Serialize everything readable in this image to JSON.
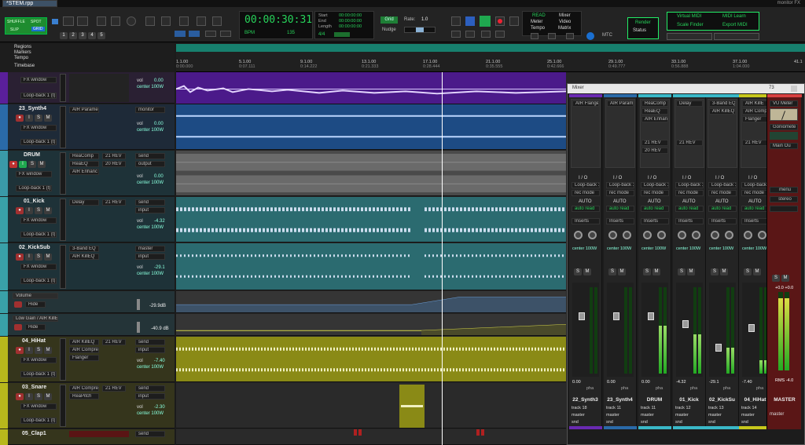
{
  "window": {
    "tab_title": "*STEM.rpp",
    "right_label": "monitor FX"
  },
  "toolbar": {
    "mode_buttons": [
      "SHUFFLE",
      "SPOT",
      "SLIP",
      "GRID"
    ],
    "zoom_numbers": [
      "1",
      "2",
      "3",
      "4",
      "5"
    ],
    "time": "00:00:30:31",
    "bpm_label": "BPM",
    "bpm": "135",
    "timesig": "4/4",
    "start_label": "Start",
    "end_label": "End",
    "length_label": "Length",
    "start": "00:00:00:00",
    "end": "00:00:00:00",
    "length": "00:00:00:00",
    "grid_label": "Grid",
    "rate_label": "Rate:",
    "rate": "1.0",
    "nudge_label": "Nudge",
    "read": "READ",
    "meter": "Meter",
    "tempo": "Tempo",
    "mixer": "Mixer",
    "video": "Video",
    "matrix": "Matrix",
    "mtc": "MTC",
    "render": "Render",
    "status": "Status",
    "virtual_midi": "Virtual MIDI",
    "midi_learn": "MIDI Learn",
    "scale_finder": "Scale Finder",
    "export_midi": "Export MIDI"
  },
  "ruler": {
    "labels": [
      "Regions",
      "Markers",
      "Tempo",
      "Timebase"
    ],
    "bars": [
      "1.1.00",
      "5.1.00",
      "9.1.00",
      "13.1.00",
      "17.1.00",
      "21.1.00",
      "25.1.00",
      "29.1.00",
      "33.1.00",
      "37.1.00",
      "41.1"
    ],
    "times": [
      "0:00.000",
      "0:07.111",
      "0:14.222",
      "0:21.333",
      "0:28.444",
      "0:35.555",
      "0:42.666",
      "0:49.777",
      "0:56.888",
      "1:04.000",
      ""
    ]
  },
  "tracks": [
    {
      "name": "",
      "fx": "FX window",
      "loop": "Loop-back 1 (t) / -",
      "slots": [],
      "vol": "0.00",
      "pan": "center",
      "width": "100W",
      "route": "",
      "color": "#5a1f9a"
    },
    {
      "name": "23_Synth4",
      "fx": "FX window",
      "loop": "Loop-back 1 (t) / -",
      "slots": [
        "AIR Parame"
      ],
      "vol": "0.00",
      "pan": "center",
      "width": "100W",
      "route": "monitor",
      "color": "#2a6aa8"
    },
    {
      "name": "DRUM",
      "fx": "FX window",
      "loop": "Loop-back 1 (t) / -",
      "slots": [
        "ReaComp",
        "ReaEQ",
        "AIR Enhanc"
      ],
      "rev": [
        "21 REV",
        "20 REV"
      ],
      "vol": "0.00",
      "pan": "center",
      "width": "100W",
      "route": "output",
      "color": "#3a9aa8"
    },
    {
      "name": "01_Kick",
      "fx": "FX window",
      "loop": "Loop-back 1 (t) / -",
      "slots": [
        "Delay"
      ],
      "rev": [
        "21 REV"
      ],
      "vol": "-4.32",
      "pan": "center",
      "width": "100W",
      "route": "send",
      "color": "#39a1a8"
    },
    {
      "name": "02_KickSub",
      "fx": "FX window",
      "loop": "Loop-back 1 (t) / -",
      "slots": [
        "3-Band EQ",
        "AIR KillEQ"
      ],
      "rev": [],
      "vol": "-29.1",
      "pan": "center",
      "width": "100W",
      "route": "master",
      "color": "#39a1a8"
    },
    {
      "name": "04_HiHat",
      "fx": "FX window",
      "loop": "Loop-back 1 (t) / -",
      "slots": [
        "AIR KillEQ",
        "AIR Compre",
        "Flanger"
      ],
      "rev": [
        "21 REV"
      ],
      "vol": "-7.40",
      "pan": "center",
      "width": "100W",
      "route": "send",
      "color": "#b8b81c"
    },
    {
      "name": "03_Snare",
      "fx": "FX window",
      "loop": "Loop-back 1 (t) / -",
      "slots": [
        "AIR Compre",
        "ReaPitch"
      ],
      "rev": [
        "21 REV"
      ],
      "vol": "-2.30",
      "pan": "center",
      "width": "100W",
      "route": "send",
      "color": "#b8b81c"
    },
    {
      "name": "05_Clap1",
      "fx": "",
      "loop": "",
      "slots": [],
      "vol": "",
      "pan": "",
      "width": "",
      "route": "send",
      "color": "#b8b81c"
    }
  ],
  "envelopes": [
    {
      "name": "Volume",
      "mode": "Hide",
      "value": "-29.9dB"
    },
    {
      "name": "Low Gain / AIR KillEQ",
      "mode": "Hide",
      "value": "-40.9 dB"
    }
  ],
  "io_labels": {
    "io": "I / O",
    "rec": "rec mode",
    "auto": "AUTO",
    "trim": "auto read",
    "inserts": "Inserts",
    "solo": "S",
    "mute": "M",
    "pha": "pha",
    "track": "track",
    "master": "master",
    "snd": "snd"
  },
  "mixer": {
    "title": "Mixer",
    "count": "73",
    "strips": [
      {
        "name": "22_Synth3",
        "slots": [
          "AIR Flanger"
        ],
        "vol": "0.00",
        "pan": "center",
        "width": "100W",
        "num": "18",
        "color": "#6a2ab2",
        "fader": 0.3,
        "meter": 0
      },
      {
        "name": "23_Synth4",
        "slots": [
          "AIR Parame"
        ],
        "vol": "0.00",
        "pan": "center",
        "width": "100W",
        "num": "11",
        "color": "#2a6aa8",
        "fader": 0.3,
        "meter": 0
      },
      {
        "name": "DRUM",
        "slots": [
          "ReaComp",
          "ReaEQ",
          "AIR Enhanc"
        ],
        "rev": [
          "21 REV",
          "20 REV"
        ],
        "vol": "0.00",
        "pan": "center",
        "width": "100W",
        "num": "11",
        "color": "#3ab8c8",
        "fader": 0.3,
        "meter": 0.55
      },
      {
        "name": "01_Kick",
        "slots": [
          "Delay"
        ],
        "rev": [
          "21 REV"
        ],
        "vol": "-4.32",
        "pan": "center",
        "width": "100W",
        "num": "12",
        "color": "#3ab8c8",
        "fader": 0.4,
        "meter": 0.45
      },
      {
        "name": "02_KickSu",
        "slots": [
          "3-Band EQ",
          "AIR KillEQ"
        ],
        "vol": "-29.1",
        "pan": "center",
        "width": "100W",
        "num": "13",
        "color": "#3ab8c8",
        "fader": 0.7,
        "meter": 0.3
      },
      {
        "name": "04_HiHat",
        "slots": [
          "AIR KillE",
          "AIR Comp",
          "Flanger"
        ],
        "rev": [
          "21 REV"
        ],
        "vol": "-7.40",
        "pan": "center",
        "width": "100W",
        "num": "14",
        "color": "#c8c81c",
        "fader": 0.45,
        "meter": 0.15
      }
    ],
    "master": {
      "name": "MASTER",
      "slots": [
        "VU Meter",
        "Goniomete",
        "Main Ou"
      ],
      "menu": "menu",
      "stereo": "stereo",
      "peak": "+0.0 +0.0",
      "rms": "RMS -4.0",
      "vol": "0.00"
    }
  },
  "colors": {
    "accent": "#1fa84f",
    "bg": "#1b1b1b"
  }
}
